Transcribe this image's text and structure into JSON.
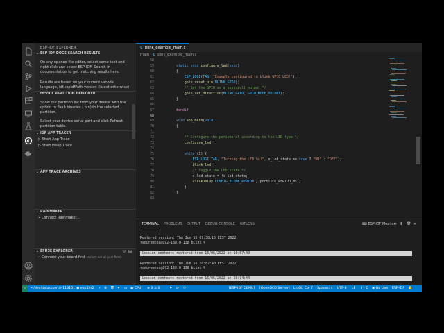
{
  "sidebar": {
    "title": "ESP-IDF EXPLORER",
    "sections": {
      "docs": {
        "label": "ESP-IDF DOCS SEARCH RESULTS",
        "para1": "On any opened file editor, select some text and right click and select ESP-IDF: Search in documentation to get matching results here.",
        "para2": "Results are based on your current vscode language, idf.espIdfPath version (latest otherwise) and"
      },
      "partition": {
        "label": "DEVICE PARTITION EXPLORER",
        "para1": "Show the partition list from your device with the option to flash binaries (.bin) to the selected partition.",
        "para2": "Select your device serial port and click Refresh partition table."
      },
      "tracer": {
        "label": "IDF APP TRACER",
        "items": [
          "Start App Trace",
          "Start Heap Trace"
        ]
      },
      "archives": {
        "label": "APP TRACE ARCHIVES"
      },
      "rainmaker": {
        "label": "RAINMAKER",
        "items": [
          "Connect Rainmaker..."
        ]
      },
      "efuse": {
        "label": "EFUSE EXPLORER",
        "item": "Connect your board first",
        "hint": "(select serial port first)"
      }
    }
  },
  "editor": {
    "tab": "blink_example_main.c",
    "breadcrumb": [
      "main",
      "blink_example_main.c"
    ],
    "lines": [
      {
        "n": "58",
        "t": ""
      },
      {
        "n": "59",
        "t": "static void configure_led(void)"
      },
      {
        "n": "60",
        "t": "{"
      },
      {
        "n": "61",
        "t": "    ESP_LOGI(TAG, \"Example configured to blink GPIO LED!\");"
      },
      {
        "n": "62",
        "t": "    gpio_reset_pin(BLINK_GPIO);"
      },
      {
        "n": "63",
        "t": "    /* Set the GPIO as a push/pull output */"
      },
      {
        "n": "64",
        "t": "    gpio_set_direction(BLINK_GPIO, GPIO_MODE_OUTPUT);"
      },
      {
        "n": "65",
        "t": "}"
      },
      {
        "n": "66",
        "t": ""
      },
      {
        "n": "67",
        "t": "#endif"
      },
      {
        "n": "68",
        "t": ""
      },
      {
        "n": "69",
        "t": "void app_main(void)"
      },
      {
        "n": "70",
        "t": "{"
      },
      {
        "n": "71",
        "t": ""
      },
      {
        "n": "72",
        "t": "    /* Configure the peripheral according to the LED type */"
      },
      {
        "n": "73",
        "t": "    configure_led();"
      },
      {
        "n": "74",
        "t": ""
      },
      {
        "n": "75",
        "t": "    while (1) {"
      },
      {
        "n": "76",
        "t": "        ESP_LOGI(TAG, \"Turning the LED %s!\", s_led_state == true ? \"ON\" : \"OFF\");"
      },
      {
        "n": "77",
        "t": "        blink_led();"
      },
      {
        "n": "78",
        "t": "        /* Toggle the LED state */"
      },
      {
        "n": "79",
        "t": "        s_led_state = !s_led_state;"
      },
      {
        "n": "80",
        "t": "        vTaskDelay(CONFIG_BLINK_PERIOD / portTICK_PERIOD_MS);"
      },
      {
        "n": "81",
        "t": "    }"
      },
      {
        "n": "82",
        "t": "}"
      },
      {
        "n": "83",
        "t": ""
      }
    ]
  },
  "panel": {
    "tabs": [
      "TERMINAL",
      "PROBLEMS",
      "OUTPUT",
      "DEBUG CONSOLE",
      "GITLENS"
    ],
    "terminal_name": "ESP-IDF Monitor",
    "lines": [
      {
        "t": "Restored session: Thu Jun 16 09:58:15 EEST 2022",
        "bar": false
      },
      {
        "t": "raduremtea@192-168-0-138 blink %",
        "bar": false
      },
      {
        "t": "",
        "bar": false
      },
      {
        "t": "Session contents restored from 16/06/2022 at 10:07:40",
        "bar": true
      },
      {
        "t": "",
        "bar": false
      },
      {
        "t": "Restored session: Thu Jun 16 10:07:40 EEST 2022",
        "bar": false
      },
      {
        "t": "raduremtea@192-168-0-138 blink %",
        "bar": false
      },
      {
        "t": "",
        "bar": false
      },
      {
        "t": "Session contents restored from 16/06/2022 at 10:14:44",
        "bar": true
      },
      {
        "t": "",
        "bar": false
      },
      {
        "t": "Restored session: Thu Jun 16 10:14:45 EEST 2022",
        "bar": false
      },
      {
        "t": "raduremtea@192-168-0-138 blink %",
        "bar": false
      }
    ]
  },
  "status": {
    "path": "/dev/tty.usbserial-113101",
    "target": "esp32s2",
    "cpu": "CPU",
    "errors": "0",
    "warnings": "0",
    "qemu": "[ESP-IDF QEMU]",
    "openocd": "[OpenOCD Server]",
    "position": "Ln 68, Col 7",
    "spaces": "Spaces: 4",
    "encoding": "UTF-8",
    "eol": "LF",
    "language": "C",
    "golive": "Go Live",
    "idf": "ESP-IDF"
  },
  "colors": {
    "accent": "#007acc",
    "keyword": "#569cd6",
    "string": "#ce9178",
    "comment": "#6a9955",
    "function": "#dcdcaa",
    "macro": "#4fc1ff",
    "preproc": "#c586c0"
  }
}
